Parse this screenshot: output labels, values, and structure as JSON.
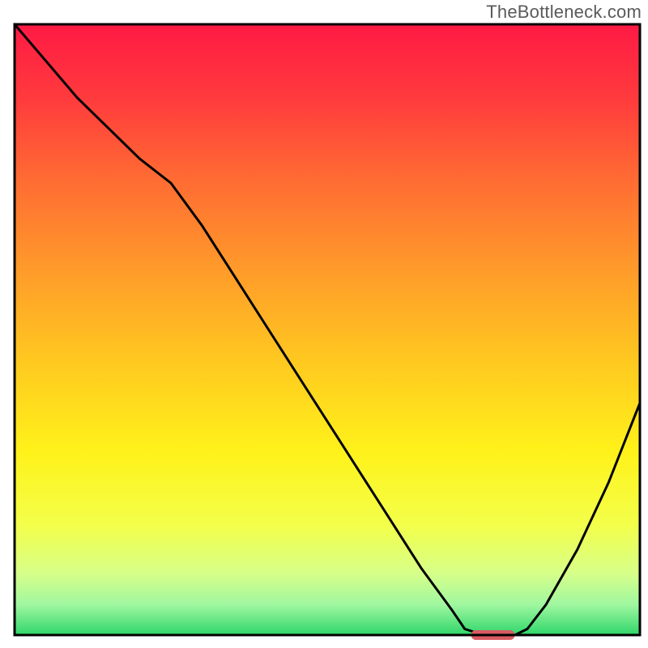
{
  "watermark": "TheBottleneck.com",
  "chart_data": {
    "type": "line",
    "title": "",
    "xlabel": "",
    "ylabel": "",
    "xlim": [
      0,
      100
    ],
    "ylim": [
      0,
      100
    ],
    "x": [
      0,
      5,
      10,
      15,
      20,
      25,
      30,
      35,
      40,
      45,
      50,
      55,
      60,
      65,
      70,
      72,
      75,
      78,
      80,
      82,
      85,
      90,
      95,
      100
    ],
    "values": [
      100,
      94,
      88,
      83,
      78,
      74,
      67,
      59,
      51,
      43,
      35,
      27,
      19,
      11,
      4,
      1,
      0,
      0,
      0,
      1,
      5,
      14,
      25,
      38
    ],
    "optimum_marker": {
      "x_start": 73,
      "x_end": 80,
      "y": 0,
      "color": "#d95b62"
    },
    "background_gradient": {
      "stops": [
        {
          "offset": 0.0,
          "color": "#ff1a44"
        },
        {
          "offset": 0.12,
          "color": "#ff3a3d"
        },
        {
          "offset": 0.25,
          "color": "#ff6a33"
        },
        {
          "offset": 0.4,
          "color": "#ff9a2a"
        },
        {
          "offset": 0.55,
          "color": "#ffc820"
        },
        {
          "offset": 0.7,
          "color": "#fff21a"
        },
        {
          "offset": 0.82,
          "color": "#f3ff4a"
        },
        {
          "offset": 0.9,
          "color": "#d6ff8a"
        },
        {
          "offset": 0.95,
          "color": "#a0f7a0"
        },
        {
          "offset": 1.0,
          "color": "#2fd66b"
        }
      ]
    },
    "curve_color": "#000000",
    "border_color": "#000000"
  }
}
